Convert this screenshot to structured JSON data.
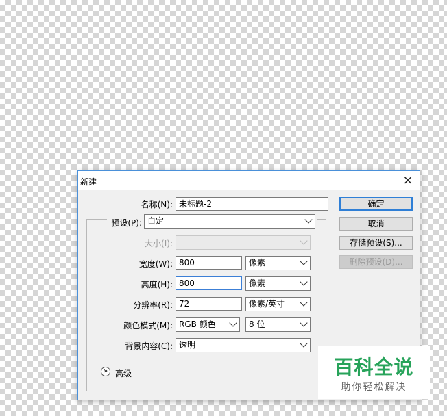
{
  "dialog": {
    "title": "新建",
    "close_glyph": "×",
    "fields": {
      "name": {
        "label": "名称(N):",
        "value": "未标题-2"
      },
      "preset": {
        "label": "预设(P):",
        "value": "自定"
      },
      "size": {
        "label": "大小(I):",
        "value": ""
      },
      "width": {
        "label": "宽度(W):",
        "value": "800",
        "unit": "像素"
      },
      "height": {
        "label": "高度(H):",
        "value": "800",
        "unit": "像素"
      },
      "resolution": {
        "label": "分辨率(R):",
        "value": "72",
        "unit": "像素/英寸"
      },
      "color_mode": {
        "label": "颜色模式(M):",
        "value": "RGB 颜色",
        "depth": "8 位"
      },
      "background": {
        "label": "背景内容(C):",
        "value": "透明"
      }
    },
    "advanced": {
      "label": "高级",
      "icon": "chevron-double-down-icon"
    },
    "buttons": {
      "ok": "确定",
      "cancel": "取消",
      "save_preset": "存储预设(S)...",
      "delete_preset": "删除预设(D)..."
    }
  },
  "watermark": {
    "title": "百科全说",
    "subtitle": "助你轻松解决",
    "color": "#27a35a"
  }
}
